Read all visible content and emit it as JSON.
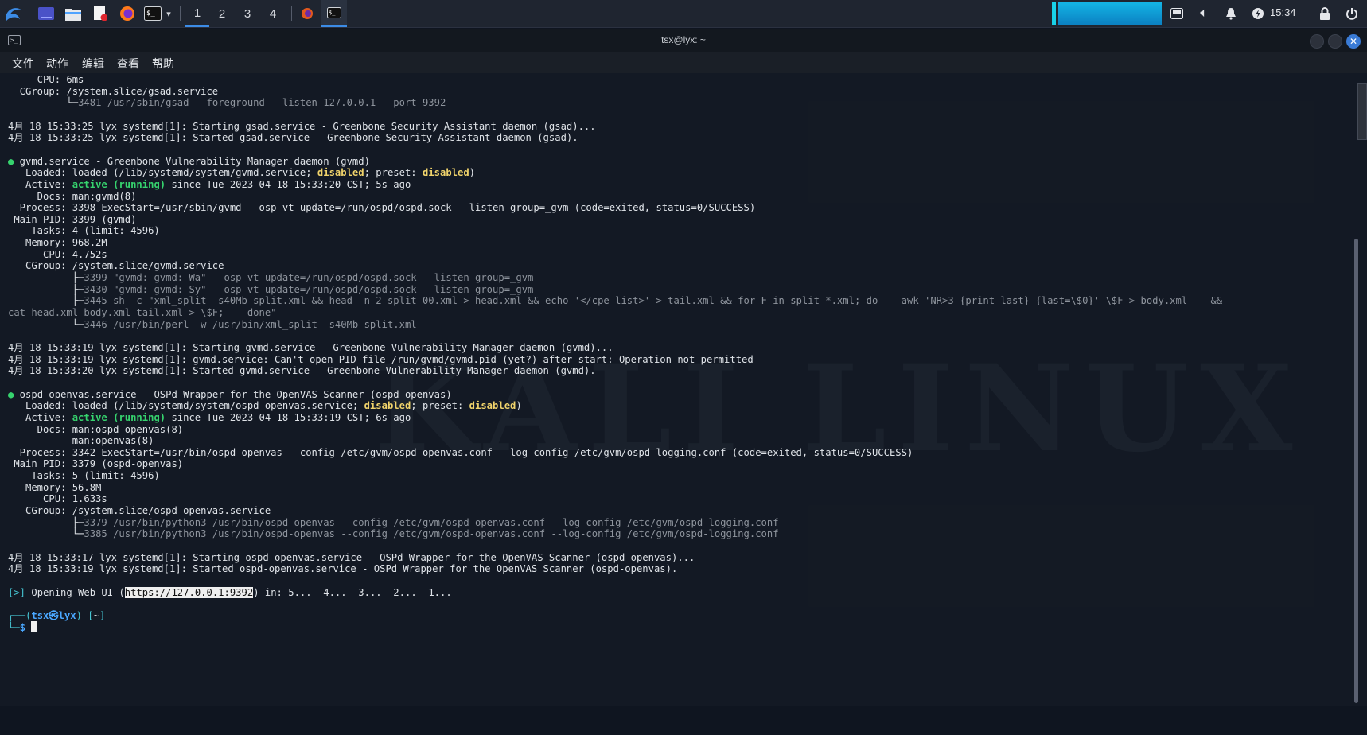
{
  "panel": {
    "workspaces": [
      "1",
      "2",
      "3",
      "4"
    ],
    "active_workspace": "1",
    "clock": "15:34",
    "icons": [
      "kali-menu-icon",
      "desktop-icon",
      "file-manager-icon",
      "text-editor-icon",
      "firefox-icon",
      "terminal-icon",
      "dropdown-icon"
    ],
    "tray_icons": [
      "window-switcher-icon",
      "volume-icon",
      "notification-bell-icon",
      "power-icon",
      "lock-icon",
      "power-off-icon"
    ]
  },
  "window": {
    "title": "tsx@lyx: ~",
    "menu": [
      "文件",
      "动作",
      "编辑",
      "查看",
      "帮助"
    ]
  },
  "terminal": {
    "lines": [
      {
        "t": "     CPU: 6ms"
      },
      {
        "t": "  CGroup: /system.slice/gsad.service"
      },
      {
        "t": "          └─3481 /usr/sbin/gsad --foreground --listen 127.0.0.1 --port 9392",
        "cls": "tree"
      },
      {
        "t": ""
      },
      {
        "t": "4月 18 15:33:25 lyx systemd[1]: Starting gsad.service - Greenbone Security Assistant daemon (gsad)..."
      },
      {
        "t": "4月 18 15:33:25 lyx systemd[1]: Started gsad.service - Greenbone Security Assistant daemon (gsad)."
      },
      {
        "t": ""
      },
      {
        "t": "● gvmd.service - Greenbone Vulnerability Manager daemon (gvmd)",
        "cls": "svc"
      },
      {
        "t": "   Loaded: loaded (/lib/systemd/system/gvmd.service; disabled; preset: disabled)",
        "cls": "loaded"
      },
      {
        "t": "   Active: active (running) since Tue 2023-04-18 15:33:20 CST; 5s ago",
        "cls": "active"
      },
      {
        "t": "     Docs: man:gvmd(8)"
      },
      {
        "t": "  Process: 3398 ExecStart=/usr/sbin/gvmd --osp-vt-update=/run/ospd/ospd.sock --listen-group=_gvm (code=exited, status=0/SUCCESS)"
      },
      {
        "t": " Main PID: 3399 (gvmd)"
      },
      {
        "t": "    Tasks: 4 (limit: 4596)"
      },
      {
        "t": "   Memory: 968.2M"
      },
      {
        "t": "      CPU: 4.752s"
      },
      {
        "t": "   CGroup: /system.slice/gvmd.service"
      },
      {
        "t": "           ├─3399 \"gvmd: gvmd: Wa\" --osp-vt-update=/run/ospd/ospd.sock --listen-group=_gvm",
        "cls": "tree"
      },
      {
        "t": "           ├─3430 \"gvmd: gvmd: Sy\" --osp-vt-update=/run/ospd/ospd.sock --listen-group=_gvm",
        "cls": "tree"
      },
      {
        "t": "           ├─3445 sh -c \"xml_split -s40Mb split.xml && head -n 2 split-00.xml > head.xml && echo '</cpe-list>' > tail.xml && for F in split-*.xml; do    awk 'NR>3 {print last} {last=\\$0}' \\$F > body.xml    &&",
        "cls": "tree"
      },
      {
        "t": "cat head.xml body.xml tail.xml > \\$F;    done\"",
        "cls": "tree"
      },
      {
        "t": "           └─3446 /usr/bin/perl -w /usr/bin/xml_split -s40Mb split.xml",
        "cls": "tree"
      },
      {
        "t": ""
      },
      {
        "t": "4月 18 15:33:19 lyx systemd[1]: Starting gvmd.service - Greenbone Vulnerability Manager daemon (gvmd)..."
      },
      {
        "t": "4月 18 15:33:19 lyx systemd[1]: gvmd.service: Can't open PID file /run/gvmd/gvmd.pid (yet?) after start: Operation not permitted"
      },
      {
        "t": "4月 18 15:33:20 lyx systemd[1]: Started gvmd.service - Greenbone Vulnerability Manager daemon (gvmd)."
      },
      {
        "t": ""
      },
      {
        "t": "● ospd-openvas.service - OSPd Wrapper for the OpenVAS Scanner (ospd-openvas)",
        "cls": "svc"
      },
      {
        "t": "   Loaded: loaded (/lib/systemd/system/ospd-openvas.service; disabled; preset: disabled)",
        "cls": "loaded"
      },
      {
        "t": "   Active: active (running) since Tue 2023-04-18 15:33:19 CST; 6s ago",
        "cls": "active"
      },
      {
        "t": "     Docs: man:ospd-openvas(8)"
      },
      {
        "t": "           man:openvas(8)"
      },
      {
        "t": "  Process: 3342 ExecStart=/usr/bin/ospd-openvas --config /etc/gvm/ospd-openvas.conf --log-config /etc/gvm/ospd-logging.conf (code=exited, status=0/SUCCESS)"
      },
      {
        "t": " Main PID: 3379 (ospd-openvas)"
      },
      {
        "t": "    Tasks: 5 (limit: 4596)"
      },
      {
        "t": "   Memory: 56.8M"
      },
      {
        "t": "      CPU: 1.633s"
      },
      {
        "t": "   CGroup: /system.slice/ospd-openvas.service"
      },
      {
        "t": "           ├─3379 /usr/bin/python3 /usr/bin/ospd-openvas --config /etc/gvm/ospd-openvas.conf --log-config /etc/gvm/ospd-logging.conf",
        "cls": "tree"
      },
      {
        "t": "           └─3385 /usr/bin/python3 /usr/bin/ospd-openvas --config /etc/gvm/ospd-openvas.conf --log-config /etc/gvm/ospd-logging.conf",
        "cls": "tree"
      },
      {
        "t": ""
      },
      {
        "t": "4月 18 15:33:17 lyx systemd[1]: Starting ospd-openvas.service - OSPd Wrapper for the OpenVAS Scanner (ospd-openvas)..."
      },
      {
        "t": "4月 18 15:33:19 lyx systemd[1]: Started ospd-openvas.service - OSPd Wrapper for the OpenVAS Scanner (ospd-openvas)."
      },
      {
        "t": ""
      },
      {
        "t": "[>] Opening Web UI (https://127.0.0.1:9392) in: 5... 4... 3... 2... 1...",
        "cls": "webui"
      },
      {
        "t": ""
      },
      {
        "t": "┌──(tsx㉿lyx)-[~]",
        "cls": "prompt1"
      },
      {
        "t": "└─$ ",
        "cls": "prompt2"
      }
    ],
    "webui_prefix": "[>]",
    "webui_text": " Opening Web UI (",
    "webui_url": "https://127.0.0.1:9392",
    "webui_suffix": ") in: 5...  4...  3...  2...  1...",
    "prompt_user": "tsx㉿lyx",
    "prompt_dir": "~"
  },
  "desktop": {
    "watermark": "KALI LINUX"
  },
  "colors": {
    "panel_bg": "#1f2530",
    "accent": "#3c8ce7",
    "terminal_fg": "#dfe3e8",
    "dim": "#8e949d",
    "yellow": "#f0d36b",
    "green": "#36d36e",
    "cyan": "#46c7d5"
  }
}
